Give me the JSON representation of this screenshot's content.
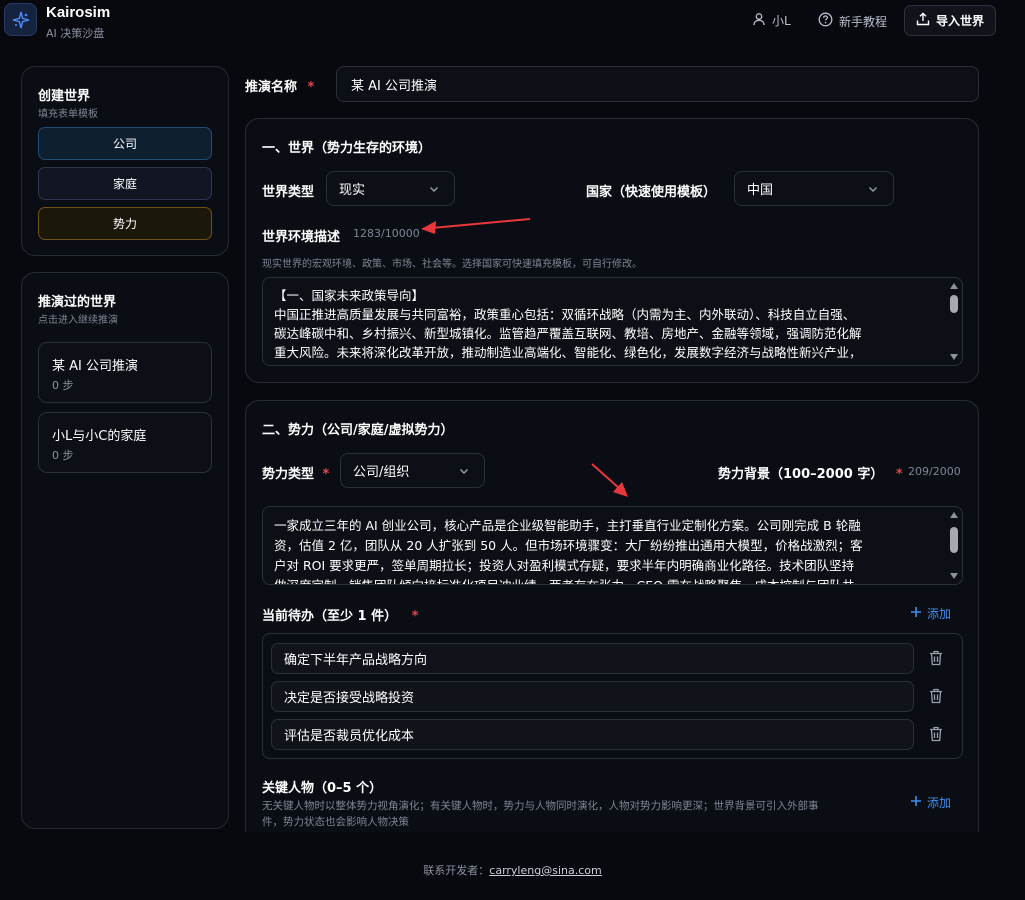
{
  "header": {
    "brand": "Kairosim",
    "subtitle": "AI 决策沙盘",
    "user_label": "小L",
    "tutorial_label": "新手教程",
    "import_label": "导入世界",
    "icons": {
      "logo": "sparkle-icon",
      "user": "user-icon",
      "help": "help-circle-icon",
      "import": "upload-icon"
    }
  },
  "sidebar": {
    "create": {
      "title": "创建世界",
      "subtitle": "填充表单模板",
      "templates": [
        "公司",
        "家庭",
        "势力"
      ]
    },
    "history": {
      "title": "推演过的世界",
      "subtitle": "点击进入继续推演",
      "worlds": [
        {
          "name": "某 AI 公司推演",
          "steps": "0 步"
        },
        {
          "name": "小L与小C的家庭",
          "steps": "0 步"
        }
      ]
    }
  },
  "main": {
    "sim_name_label": "推演名称",
    "required_mark": "*",
    "sim_name_value": "某 AI 公司推演",
    "world": {
      "title": "一、世界（势力生存的环境）",
      "type_label": "世界类型",
      "type_value": "现实",
      "country_label": "国家（快速使用模板）",
      "country_value": "中国",
      "desc_label": "世界环境描述",
      "desc_count": "1283/10000",
      "desc_hint": "现实世界的宏观环境、政策、市场、社会等。选择国家可快速填充模板，可自行修改。",
      "desc_lines": [
        "【一、国家未来政策导向】",
        "中国正推进高质量发展与共同富裕，政策重心包括：双循环战略（内需为主、内外联动）、科技自立自强、",
        "碳达峰碳中和、乡村振兴、新型城镇化。监管趋严覆盖互联网、教培、房地产、金融等领域，强调防范化解",
        "重大风险。未来将深化改革开放，推动制造业高端化、智能化、绿色化，发展数字经济与战略性新兴产业，"
      ]
    },
    "force": {
      "title": "二、势力（公司/家庭/虚拟势力）",
      "type_label": "势力类型",
      "type_value": "公司/组织",
      "bg_label": "势力背景（100–2000 字）",
      "bg_count": "209/2000",
      "bg_lines": [
        "一家成立三年的 AI 创业公司，核心产品是企业级智能助手，主打垂直行业定制化方案。公司刚完成 B 轮融",
        "资，估值 2 亿，团队从 20 人扩张到 50 人。但市场环境骤变：大厂纷纷推出通用大模型，价格战激烈；客",
        "户对 ROI 要求更严，签单周期拉长；投资人对盈利模式存疑，要求半年内明确商业化路径。技术团队坚持",
        "做深度定制，销售团队倾向接标准化项目冲业绩，两者存在张力。CEO 需在战略聚焦、成本控制与团队共"
      ],
      "todos_label": "当前待办（至少 1 件）",
      "add_label": "添加",
      "todos": [
        "确定下半年产品战略方向",
        "决定是否接受战略投资",
        "评估是否裁员优化成本"
      ],
      "people_label": "关键人物（0–5 个）",
      "people_hint_1": "无关键人物时以整体势力视角演化；有关键人物时，势力与人物同时演化，人物对势力影响更深；世界背景可引入外部事",
      "people_hint_2": "件，势力状态也会影响人物决策"
    }
  },
  "footer": {
    "prefix": "联系开发者：",
    "email": "carryleng@sina.com"
  },
  "colors": {
    "accent_blue": "#3d8ff0",
    "required_red": "#e0474f",
    "annotation_arrow": "#e8383d",
    "selected_template_border": "#1f4d73",
    "force_template_border": "#6b5418"
  }
}
